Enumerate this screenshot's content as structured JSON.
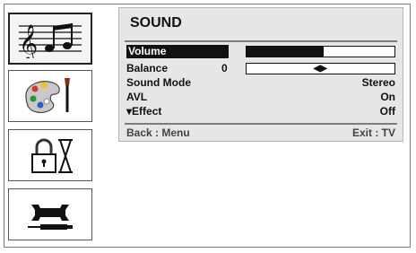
{
  "sidebar": {
    "items": [
      {
        "name": "sound",
        "icon": "music-notes-icon",
        "active": true
      },
      {
        "name": "picture",
        "icon": "paint-palette-icon",
        "active": false
      },
      {
        "name": "lock-timer",
        "icon": "lock-hourglass-icon",
        "active": false
      },
      {
        "name": "setup",
        "icon": "wrench-screwdriver-icon",
        "active": false
      }
    ]
  },
  "menu": {
    "title": "SOUND",
    "volume": {
      "label": "Volume",
      "level": 0.52
    },
    "balance": {
      "label": "Balance",
      "value": "0",
      "marker": "◀▶",
      "position": 0.5
    },
    "sound_mode": {
      "label": "Sound Mode",
      "value": "Stereo"
    },
    "avl": {
      "label": "AVL",
      "value": "On"
    },
    "effect": {
      "label": "▾Effect",
      "value": "Off"
    },
    "footer": {
      "back": "Back : Menu",
      "exit": "Exit : TV"
    }
  },
  "colors": {
    "panel_bg": "#e6e6e6",
    "highlight": "#111111",
    "rule": "#7d7d7d"
  }
}
